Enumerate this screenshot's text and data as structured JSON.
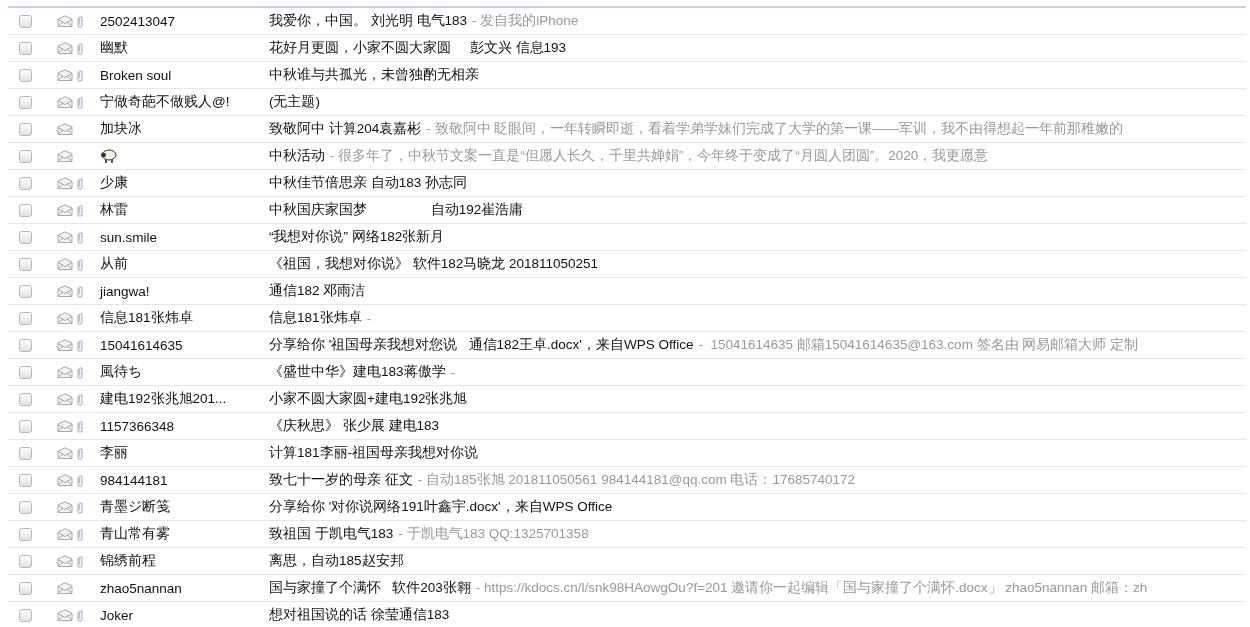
{
  "messages": [
    {
      "checked": false,
      "attachment": true,
      "kind": "text",
      "sender": "2502413047",
      "subject": "我爱你，中国。 刘光明 电气183",
      "preview": "- 发自我的iPhone"
    },
    {
      "checked": false,
      "attachment": true,
      "kind": "text",
      "sender": "幽默",
      "subject": "花好月更圆，小家不圆大家圆     彭文兴 信息193"
    },
    {
      "checked": false,
      "attachment": true,
      "kind": "text",
      "sender": "Broken soul",
      "subject": "中秋谁与共孤光，未曾独酌无相亲"
    },
    {
      "checked": false,
      "attachment": true,
      "kind": "text",
      "sender": "宁做奇葩不做贱人@!",
      "subject": "(无主题)"
    },
    {
      "checked": false,
      "attachment": false,
      "kind": "text",
      "sender": "加块冰",
      "subject": "致敬阿中 计算204袁嘉彬",
      "preview": "- 致敬阿中 眨眼间，一年转瞬即逝，看着学弟学妹们完成了大学的第一课——军训，我不由得想起一年前那稚嫩的"
    },
    {
      "checked": false,
      "attachment": false,
      "kind": "picture",
      "subject": "中秋活动",
      "preview": "- 很多年了，中秋节文案一直是“但愿人长久，千里共婵娟”，今年终于变成了“月圆人团圆”。2020，我更愿意"
    },
    {
      "checked": false,
      "attachment": true,
      "kind": "text",
      "sender": "少康",
      "subject": "中秋佳节倍思亲 自动183 孙志同"
    },
    {
      "checked": false,
      "attachment": true,
      "kind": "text",
      "sender": "林雷",
      "subject": "中秋国庆家国梦                 自动192崔浩庸"
    },
    {
      "checked": false,
      "attachment": true,
      "kind": "text",
      "sender": "sun.smile",
      "subject": "“我想对你说” 网络182张新月"
    },
    {
      "checked": false,
      "attachment": true,
      "kind": "text",
      "sender": "从前",
      "subject": "《祖国，我想对你说》 软件182马晓龙 201811050251"
    },
    {
      "checked": false,
      "attachment": true,
      "kind": "text",
      "sender": "jiangwa!",
      "subject": "通信182 邓雨洁"
    },
    {
      "checked": false,
      "attachment": true,
      "kind": "text",
      "sender": "信息181张炜卓",
      "subject": "信息181张炜卓",
      "preview": "-"
    },
    {
      "checked": false,
      "attachment": true,
      "kind": "text",
      "sender": "15041614635",
      "subject": "分享给你 '祖国母亲我想对您说   通信182王卓.docx'，来自WPS Office",
      "preview": "-  15041614635 邮箱15041614635@163.com 签名由 网易邮箱大师 定制"
    },
    {
      "checked": false,
      "attachment": true,
      "kind": "text",
      "sender": "風待ち",
      "subject": "《盛世中华》建电183蒋傲学",
      "preview": "-"
    },
    {
      "checked": false,
      "attachment": true,
      "kind": "text",
      "sender": "建电192张兆旭201...",
      "subject": "小家不圆大家圆+建电192张兆旭"
    },
    {
      "checked": false,
      "attachment": true,
      "kind": "text",
      "sender": "1157366348",
      "subject": "《庆秋思》 张少展 建电183"
    },
    {
      "checked": false,
      "attachment": true,
      "kind": "text",
      "sender": "李丽",
      "subject": "计算181李丽-祖国母亲我想对你说"
    },
    {
      "checked": false,
      "attachment": true,
      "kind": "text",
      "sender": "984144181",
      "subject": "致七十一岁的母亲 征文",
      "preview": "- 自动185张旭 201811050561 984144181@qq.com 电话：17685740172"
    },
    {
      "checked": false,
      "attachment": true,
      "kind": "text",
      "sender": "青墨ジ断笺",
      "subject": "分享给你 '对你说网络191叶鑫宇.docx'，来自WPS Office"
    },
    {
      "checked": false,
      "attachment": true,
      "kind": "text",
      "sender": "青山常有雾",
      "subject": "致祖国 于凯电气183",
      "preview": "- 于凯电气183 QQ:1325701358"
    },
    {
      "checked": false,
      "attachment": true,
      "kind": "text",
      "sender": "锦绣前程",
      "subject": "离思，自动185赵安邦"
    },
    {
      "checked": false,
      "attachment": false,
      "kind": "text",
      "sender": "zhao5nannan",
      "subject": "国与家撞了个满怀   软件203张翱",
      "preview": "- https://kdocs.cn/l/snk98HAowgOu?f=201 邀请你一起编辑「国与家撞了个满怀.docx」 zhao5nannan 邮箱：zh"
    },
    {
      "checked": false,
      "attachment": true,
      "kind": "text",
      "sender": "Joker",
      "subject": "想对祖国说的话 徐莹通信183"
    }
  ]
}
